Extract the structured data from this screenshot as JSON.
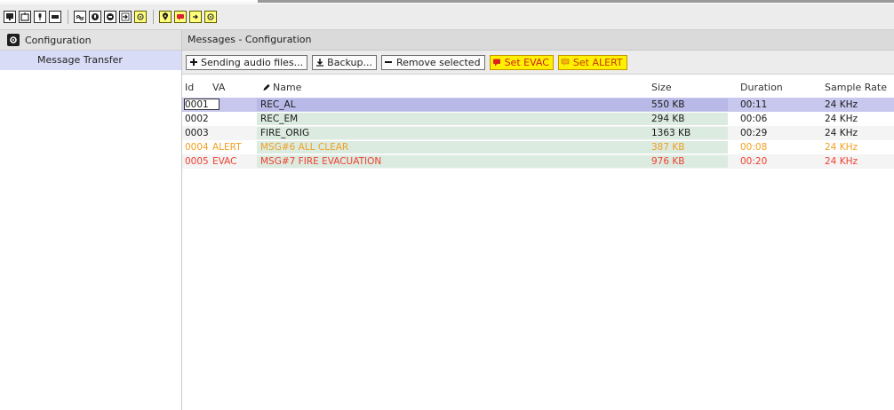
{
  "toolbar": {
    "icons_group1": [
      "display-icon",
      "window-icon",
      "microphone-icon",
      "stop-icon"
    ],
    "icons_group2": [
      "waveform-icon",
      "microphone-icon",
      "message-icon",
      "transfer-icon",
      "settings-icon"
    ],
    "icons_group3": [
      "location-icon",
      "message-icon",
      "transfer-icon",
      "settings-icon"
    ]
  },
  "sidebar": {
    "header": "Configuration",
    "items": [
      {
        "label": "Message Transfer"
      }
    ]
  },
  "main": {
    "title": "Messages - Configuration",
    "actions": {
      "send": "Sending audio files...",
      "backup": "Backup...",
      "remove": "Remove selected",
      "set_evac": "Set EVAC",
      "set_alert": "Set ALERT"
    },
    "columns": {
      "id": "Id",
      "va": "VA",
      "name": "Name",
      "size": "Size",
      "duration": "Duration",
      "rate": "Sample Rate"
    },
    "rows": [
      {
        "id": "0001",
        "va": "",
        "name": "REC_AL",
        "size": "550 KB",
        "duration": "00:11",
        "rate": "24 KHz"
      },
      {
        "id": "0002",
        "va": "",
        "name": "REC_EM",
        "size": "294 KB",
        "duration": "00:06",
        "rate": "24 KHz"
      },
      {
        "id": "0003",
        "va": "",
        "name": "FIRE_ORIG",
        "size": "1363 KB",
        "duration": "00:29",
        "rate": "24 KHz"
      },
      {
        "id": "0004",
        "va": "ALERT",
        "name": "MSG#6 ALL CLEAR",
        "size": "387 KB",
        "duration": "00:08",
        "rate": "24 KHz"
      },
      {
        "id": "0005",
        "va": "EVAC",
        "name": "MSG#7 FIRE EVACUATION",
        "size": "976 KB",
        "duration": "00:20",
        "rate": "24 KHz"
      }
    ]
  },
  "colors": {
    "alert_text": "#f0a020",
    "evac_text": "#f04030",
    "selected_row": "#c8c8ee",
    "sidebar_selected": "#d9dcf7",
    "yellow_button": "#ffef00"
  }
}
